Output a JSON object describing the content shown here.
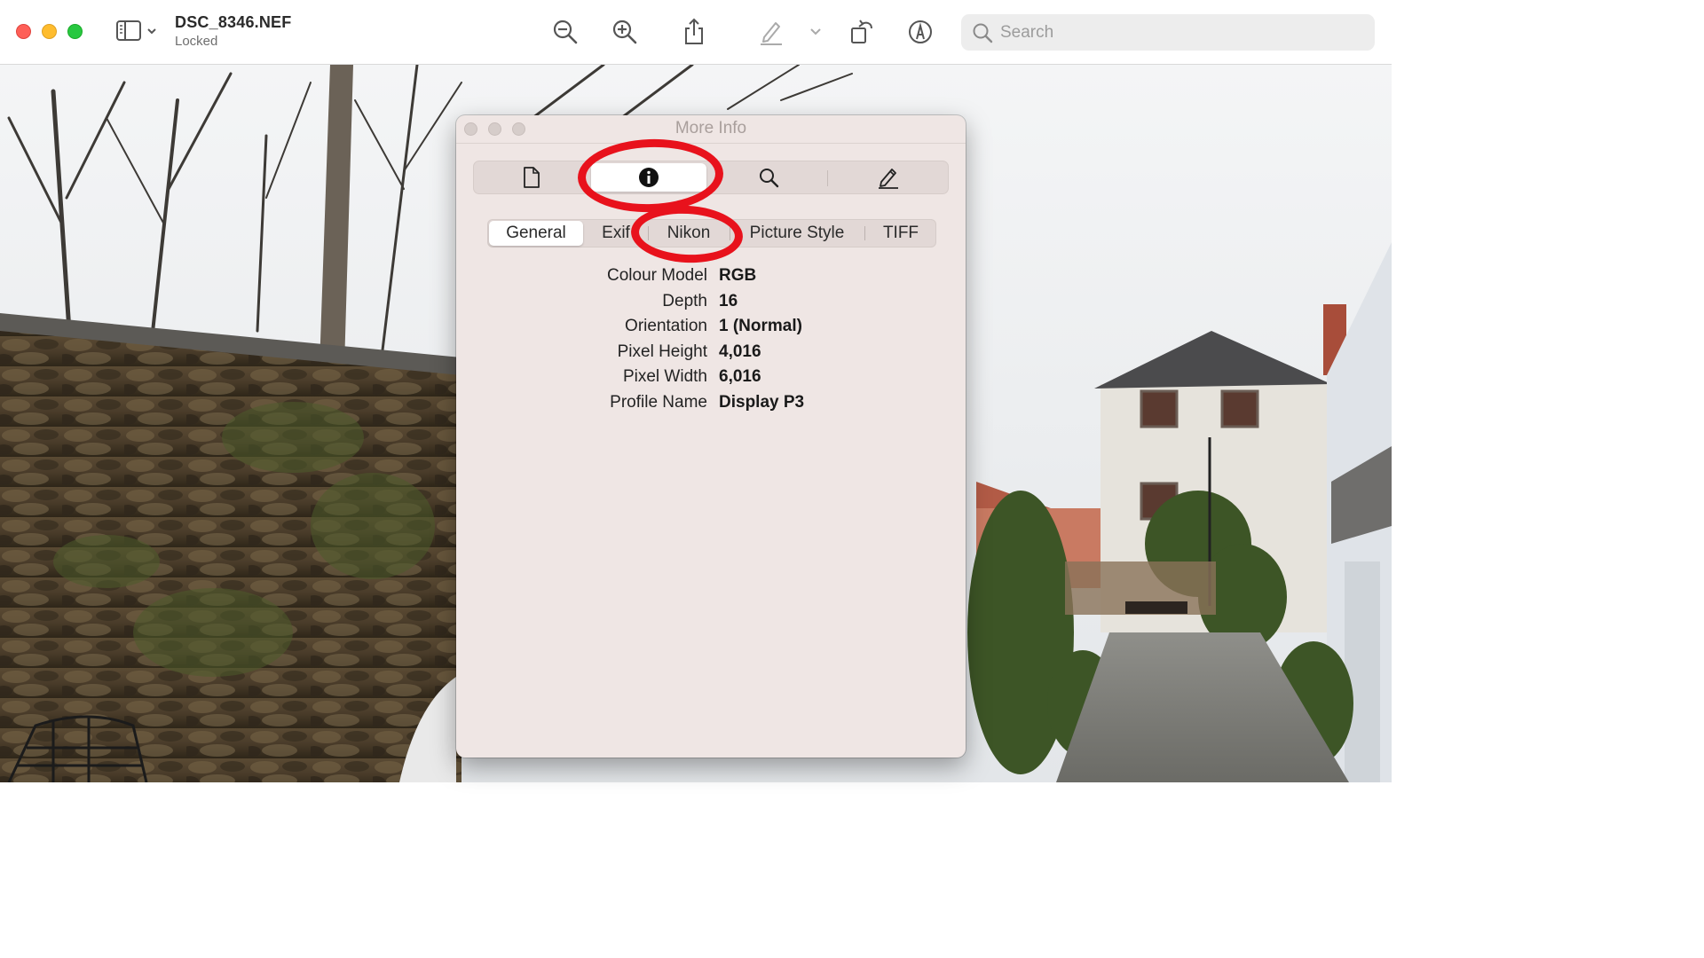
{
  "window": {
    "title": "DSC_8346.NEF",
    "subtitle": "Locked"
  },
  "toolbar": {
    "icons": [
      "sidebar-toggle-icon",
      "zoom-out-icon",
      "zoom-in-icon",
      "share-icon",
      "markup-pen-icon",
      "chevron-down-icon",
      "rotate-icon",
      "annotate-icon"
    ],
    "search_placeholder": "Search"
  },
  "panel": {
    "title": "More Info",
    "inspector_tabs": [
      "file-icon",
      "info-icon",
      "search-icon",
      "pencil-icon"
    ],
    "active_inspector": "info-icon",
    "subtabs": [
      "General",
      "Exif",
      "Nikon",
      "Picture Style",
      "TIFF"
    ],
    "active_subtab": "General",
    "rows": [
      {
        "key": "Colour Model",
        "value": "RGB"
      },
      {
        "key": "Depth",
        "value": "16"
      },
      {
        "key": "Orientation",
        "value": "1 (Normal)"
      },
      {
        "key": "Pixel Height",
        "value": "4,016"
      },
      {
        "key": "Pixel Width",
        "value": "6,016"
      },
      {
        "key": "Profile Name",
        "value": "Display P3"
      }
    ]
  },
  "colors": {
    "annotation_red": "#e8121c",
    "panel_bg": "#efe6e4"
  }
}
